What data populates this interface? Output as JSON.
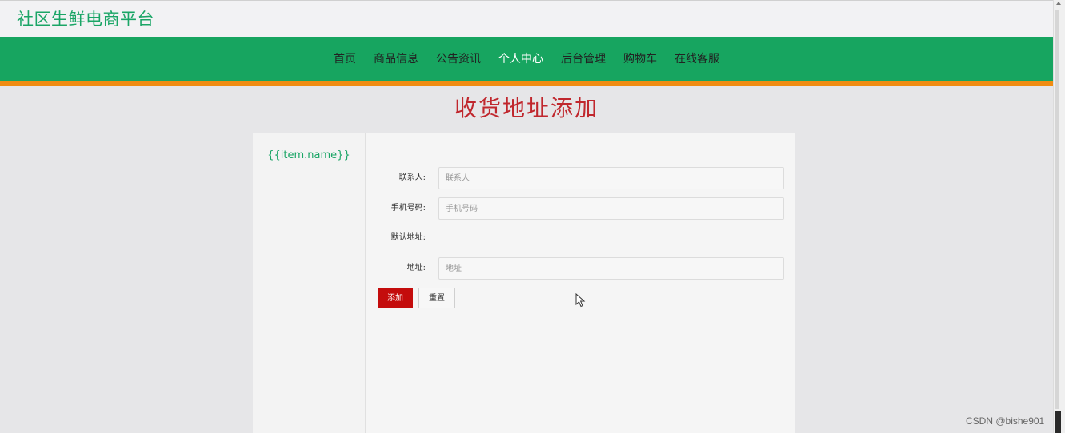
{
  "header": {
    "site_title": "社区生鲜电商平台"
  },
  "nav": {
    "items": [
      {
        "label": "首页"
      },
      {
        "label": "商品信息"
      },
      {
        "label": "公告资讯"
      },
      {
        "label": "个人中心"
      },
      {
        "label": "后台管理"
      },
      {
        "label": "购物车"
      },
      {
        "label": "在线客服"
      }
    ],
    "active_item": "个人中心"
  },
  "page": {
    "heading": "收货地址添加"
  },
  "sidebar": {
    "item_name": "{{item.name}}"
  },
  "form": {
    "contact": {
      "label": "联系人:",
      "placeholder": "联系人",
      "value": ""
    },
    "phone": {
      "label": "手机号码:",
      "placeholder": "手机号码",
      "value": ""
    },
    "default_address": {
      "label": "默认地址:"
    },
    "address": {
      "label": "地址:",
      "placeholder": "地址",
      "value": ""
    },
    "add_button": "添加",
    "reset_button": "重置"
  },
  "watermark": "CSDN @bishe901",
  "colors": {
    "brand_green": "#17a560",
    "accent_orange": "#f08c12",
    "heading_red": "#c0272d",
    "button_red": "#c40c0c"
  }
}
